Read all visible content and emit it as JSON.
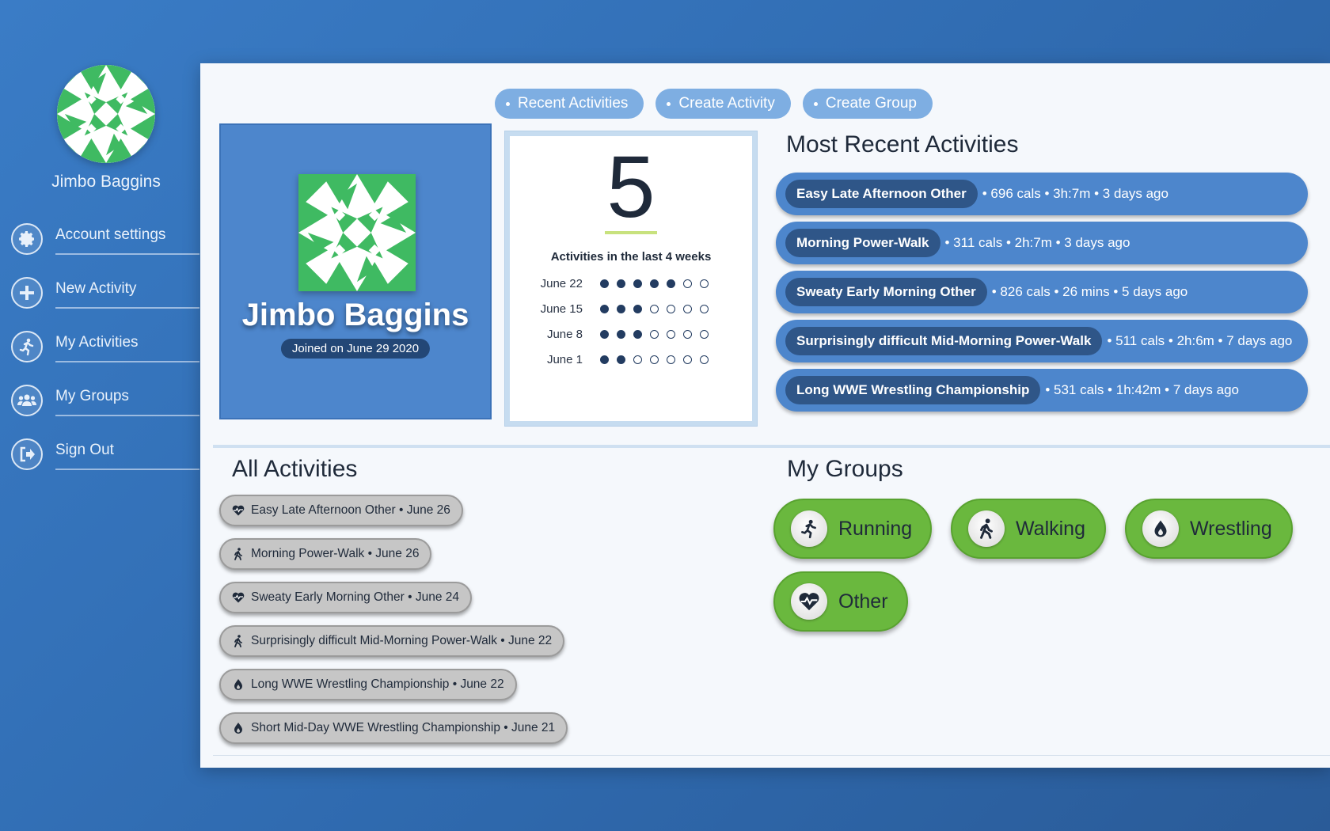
{
  "user": {
    "name": "Jimbo Baggins",
    "joined": "Joined on June 29 2020"
  },
  "sidebar": {
    "items": [
      {
        "label": "Account settings",
        "icon": "gear-icon"
      },
      {
        "label": "New Activity",
        "icon": "plus-icon"
      },
      {
        "label": "My Activities",
        "icon": "running-icon"
      },
      {
        "label": "My Groups",
        "icon": "users-icon"
      },
      {
        "label": "Sign Out",
        "icon": "sign-out-icon"
      }
    ]
  },
  "topnav": {
    "items": [
      "Recent Activities",
      "Create Activity",
      "Create Group"
    ]
  },
  "stats": {
    "count": "5",
    "title": "Activities in the last 4 weeks",
    "weeks": [
      {
        "label": "June 22",
        "filled": 5,
        "total": 7
      },
      {
        "label": "June 15",
        "filled": 3,
        "total": 7
      },
      {
        "label": "June 8",
        "filled": 3,
        "total": 7
      },
      {
        "label": "June 1",
        "filled": 2,
        "total": 7
      }
    ]
  },
  "recent": {
    "title": "Most Recent Activities",
    "items": [
      {
        "name": "Easy Late Afternoon Other",
        "meta": "• 696 cals • 3h:7m • 3 days ago"
      },
      {
        "name": "Morning Power-Walk",
        "meta": "• 311 cals • 2h:7m • 3 days ago"
      },
      {
        "name": "Sweaty Early Morning Other",
        "meta": "• 826 cals • 26 mins • 5 days ago"
      },
      {
        "name": "Surprisingly difficult Mid-Morning Power-Walk",
        "meta": "• 511 cals • 2h:6m • 7 days ago"
      },
      {
        "name": "Long WWE Wrestling Championship",
        "meta": "• 531 cals • 1h:42m • 7 days ago"
      }
    ]
  },
  "all": {
    "title": "All Activities",
    "items": [
      {
        "text": "Easy Late Afternoon Other • June 26",
        "icon": "heart-icon"
      },
      {
        "text": "Morning Power-Walk • June 26",
        "icon": "walking-icon"
      },
      {
        "text": "Sweaty Early Morning Other • June 24",
        "icon": "heart-icon"
      },
      {
        "text": "Surprisingly difficult Mid-Morning Power-Walk • June 22",
        "icon": "walking-icon"
      },
      {
        "text": "Long WWE Wrestling Championship • June 22",
        "icon": "fire-icon"
      },
      {
        "text": "Short Mid-Day WWE Wrestling Championship • June 21",
        "icon": "fire-icon"
      }
    ]
  },
  "groups": {
    "title": "My Groups",
    "items": [
      {
        "label": "Running",
        "icon": "running-icon"
      },
      {
        "label": "Walking",
        "icon": "walking-icon"
      },
      {
        "label": "Wrestling",
        "icon": "fire-icon"
      },
      {
        "label": "Other",
        "icon": "heartbeat-icon"
      }
    ]
  },
  "colors": {
    "background": "#3372bc",
    "card_blue": "#4d86cc",
    "group_green": "#6ab83e",
    "dark_navy": "#233c61"
  }
}
